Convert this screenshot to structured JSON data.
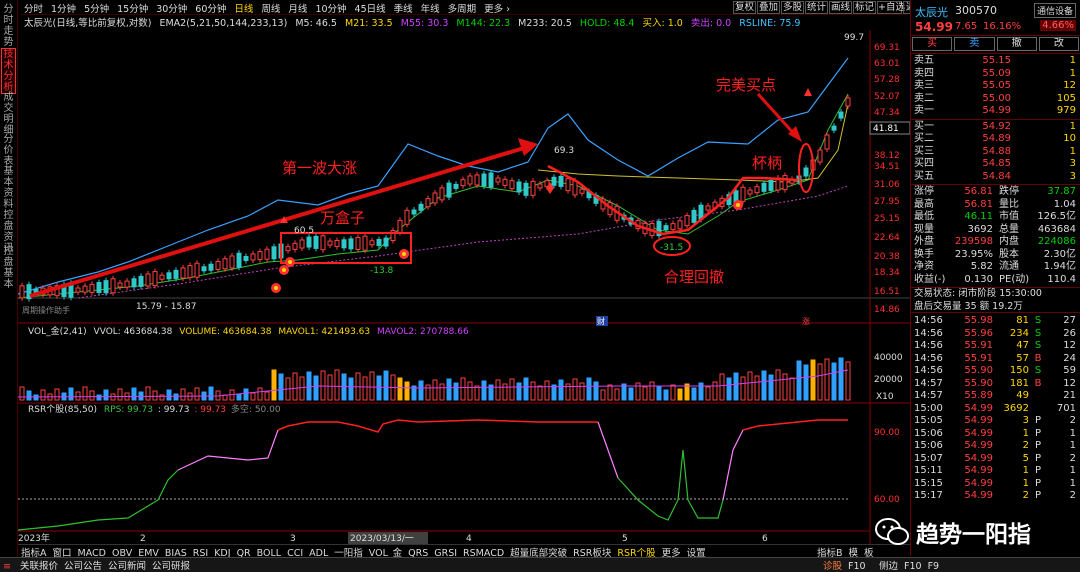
{
  "sidebar": {
    "tabs": [
      "分时走势",
      "技术分析",
      "成交明细",
      "分价表",
      "基本资料",
      "控盘资讯",
      "控盘基本"
    ],
    "active": 1
  },
  "period_bar": {
    "items": [
      "分时",
      "1分钟",
      "5分钟",
      "15分钟",
      "30分钟",
      "60分钟",
      "日线",
      "周线",
      "月线",
      "10分钟",
      "45日线",
      "季线",
      "年线",
      "多周期",
      "更多 ›"
    ],
    "active": "日线",
    "tools": [
      "复权",
      "叠加",
      "多股",
      "统计",
      "画线",
      "标记"
    ],
    "right_tools": [
      "+自选",
      "返回"
    ]
  },
  "indicator_line": {
    "name": "太辰光(日线,等比前复权,对数)",
    "ema": "EMA2(5,21,50,144,233,13)",
    "m5": "M5: 46.5",
    "m21": "M21: 33.5",
    "m55": "M55: 30.3",
    "m144": "M144: 22.3",
    "m233": "M233: 20.5",
    "hold": "HOLD: 48.4",
    "buy": "买入: 1.0",
    "sell": "卖出: 0.0",
    "rsline": "RSLINE: 75.9"
  },
  "annotations": {
    "wave": "第一波大涨",
    "box": "万盒子",
    "handle": "杯柄",
    "perfect_buy": "完美买点",
    "pullback": "合理回撤",
    "v605": "60.5",
    "v138": "-13.8",
    "v693": "69.3",
    "v315": "-31.5",
    "v997": "99.7",
    "lowrange": "15.79 - 15.87",
    "sig_cai": "财",
    "sig_zhang": "涨",
    "corner": "周期操作助手",
    "price_cur": "41.81"
  },
  "y_axis": [
    "69.31",
    "63.01",
    "57.28",
    "52.07",
    "47.34",
    "41.81",
    "38.12",
    "34.51",
    "31.06",
    "27.95",
    "25.15",
    "22.64",
    "20.38",
    "18.34",
    "16.51",
    "14.86"
  ],
  "vol_panel": {
    "title": "VOL_金(2,41)",
    "vvol": "VVOL: 463684.38",
    "volume": "VOLUME: 463684.38",
    "mavol1": "MAVOL1: 421493.63",
    "mavol2": "MAVOL2: 270788.66",
    "ticks": [
      "40000",
      "20000"
    ],
    "unit": "X10"
  },
  "rsr_panel": {
    "title": "RSR个股(85,50)",
    "rps": "RPS: 99.73",
    "v2": ": 99.73",
    "v3": ": 99.73",
    "v4": "多空: 50.00",
    "ticks": [
      "90.00",
      "60.00"
    ]
  },
  "x_axis": {
    "labels": [
      "2023年",
      "2",
      "3",
      "2023/03/13/一",
      "4",
      "5",
      "6"
    ]
  },
  "bottom_tabs": {
    "items": [
      "指标A",
      "窗口",
      "MACD",
      "OBV",
      "EMV",
      "BIAS",
      "RSI",
      "KDJ",
      "QR",
      "BOLL",
      "CCI",
      "ADL",
      "一阳指",
      "VOL_金",
      "QRS",
      "GRSI",
      "RSMACD",
      "超量底部突破",
      "RSR板块",
      "RSR个股",
      "更多",
      "设置"
    ],
    "active": "RSR个股",
    "right": [
      "指标B",
      "模",
      "板"
    ]
  },
  "status_bar": {
    "items": [
      "关联报价",
      "公司公告",
      "公司新闻",
      "公司研报"
    ],
    "right": [
      "诊股",
      "F10"
    ],
    "right2": [
      "侧边",
      "F10",
      "F9"
    ]
  },
  "quote": {
    "name": "太辰光",
    "code": "300570",
    "tag": "通信设备",
    "price": "54.99",
    "change": "7.65",
    "pct": "16.16%",
    "ratio": "4.66%",
    "buttons": [
      "买",
      "卖",
      "撤",
      "改"
    ],
    "asks": [
      [
        "卖五",
        "55.15",
        "1"
      ],
      [
        "卖四",
        "55.09",
        "1"
      ],
      [
        "卖三",
        "55.05",
        "12"
      ],
      [
        "卖二",
        "55.00",
        "105"
      ],
      [
        "卖一",
        "54.99",
        "979"
      ]
    ],
    "bids": [
      [
        "买一",
        "54.92",
        "1"
      ],
      [
        "买二",
        "54.89",
        "10"
      ],
      [
        "买三",
        "54.88",
        "1"
      ],
      [
        "买四",
        "54.85",
        "3"
      ],
      [
        "买五",
        "54.84",
        "3"
      ]
    ],
    "stats": [
      [
        "涨停",
        "56.81",
        "跌停",
        "37.87"
      ],
      [
        "最高",
        "56.81",
        "量比",
        "1.04"
      ],
      [
        "最低",
        "46.11",
        "市值",
        "126.5亿"
      ],
      [
        "现量",
        "3692",
        "总量",
        "463684"
      ],
      [
        "外盘",
        "239598",
        "内盘",
        "224086"
      ],
      [
        "换手",
        "23.95%",
        "股本",
        "2.30亿"
      ],
      [
        "净资",
        "5.82",
        "流通",
        "1.94亿"
      ],
      [
        "收益(-)",
        "0.130",
        "PE(动)",
        "110.4"
      ]
    ],
    "trade_state": "交易状态: 闭市阶段 15:30:00",
    "after": "盘后交易量 35 额 19.2万",
    "ticks": [
      [
        "14:56",
        "55.98",
        "81",
        "S",
        "27"
      ],
      [
        "14:56",
        "55.96",
        "234",
        "S",
        "26"
      ],
      [
        "14:56",
        "55.91",
        "47",
        "S",
        "12"
      ],
      [
        "14:56",
        "55.91",
        "57",
        "B",
        "24"
      ],
      [
        "14:56",
        "55.90",
        "150",
        "S",
        "59"
      ],
      [
        "14:57",
        "55.90",
        "181",
        "B",
        "12"
      ],
      [
        "14:57",
        "55.89",
        "49",
        "",
        "21"
      ],
      [
        "15:00",
        "54.99",
        "3692",
        "",
        "701"
      ],
      [
        "15:05",
        "54.99",
        "3",
        "P",
        "2"
      ],
      [
        "15:06",
        "54.99",
        "1",
        "P",
        "1"
      ],
      [
        "15:06",
        "54.99",
        "2",
        "P",
        "1"
      ],
      [
        "15:07",
        "54.99",
        "5",
        "P",
        "2"
      ],
      [
        "15:11",
        "54.99",
        "1",
        "P",
        "1"
      ],
      [
        "15:15",
        "54.99",
        "1",
        "P",
        "1"
      ],
      [
        "15:17",
        "54.99",
        "2",
        "P",
        "2"
      ]
    ]
  },
  "watermark": "趋势一阳指"
}
